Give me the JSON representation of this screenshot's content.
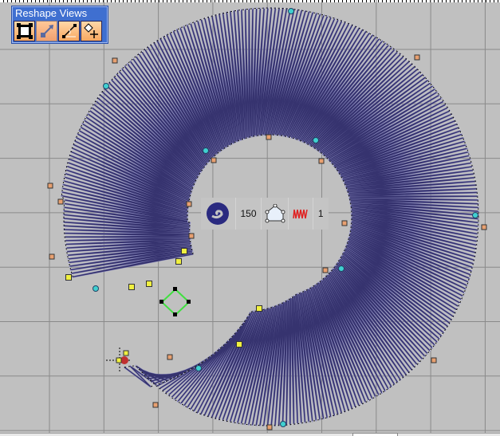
{
  "reshape_panel": {
    "title": "Reshape Views",
    "buttons": [
      {
        "icon": "show-object-icon"
      },
      {
        "icon": "stitch-angles-icon"
      },
      {
        "icon": "reshape-line-icon"
      },
      {
        "icon": "add-node-icon"
      }
    ]
  },
  "quick_toolbar": {
    "stitch_type_icon": "spiral-fill-icon",
    "density_value": "150",
    "outline_icon": "outline-shape-icon",
    "effect_icon": "satin-effect-icon",
    "trailing_value": "1"
  },
  "colors": {
    "thread": "#36336f",
    "thread_light": "#8c8cc0",
    "background": "#c0c0c0",
    "node_cyan": "#40d0d0",
    "node_orange": "#e8a070",
    "node_yellow": "#f0f040",
    "selection_green": "#40e040"
  }
}
